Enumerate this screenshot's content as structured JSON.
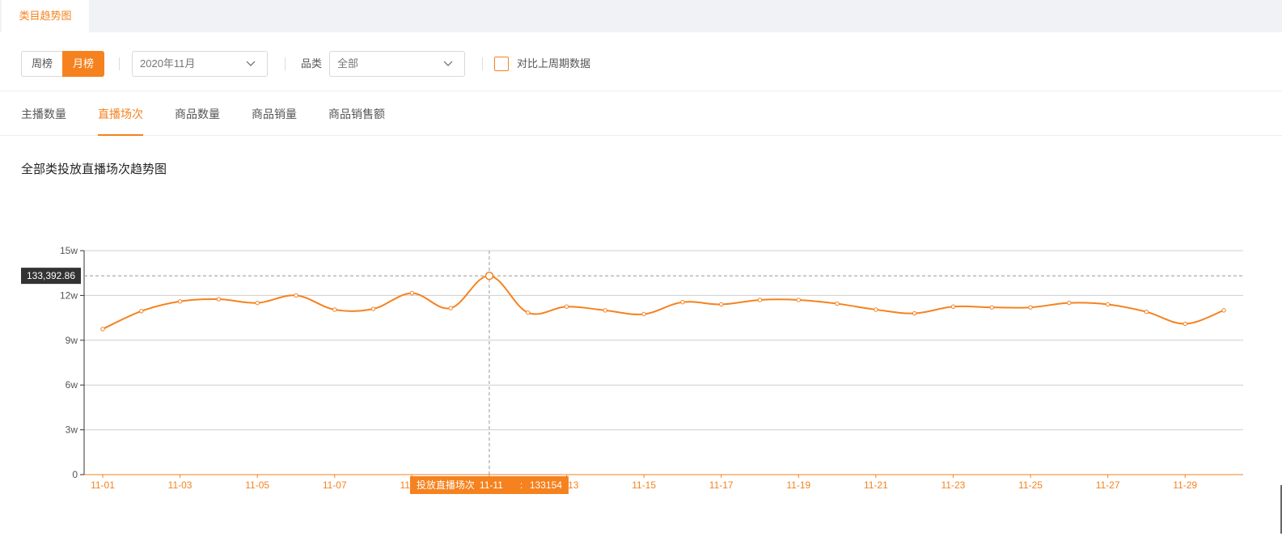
{
  "top_tab": {
    "label": "类目趋势图"
  },
  "filters": {
    "period_week_label": "周榜",
    "period_month_label": "月榜",
    "selected_period": "月榜",
    "month_select_value": "2020年11月",
    "category_label": "品类",
    "category_select_value": "全部",
    "compare_label": "对比上周期数据",
    "compare_checked": false
  },
  "tabs": [
    {
      "label": "主播数量",
      "active": false
    },
    {
      "label": "直播场次",
      "active": true
    },
    {
      "label": "商品数量",
      "active": false
    },
    {
      "label": "商品销量",
      "active": false
    },
    {
      "label": "商品销售额",
      "active": false
    }
  ],
  "colors": {
    "accent": "#f5821f",
    "grid": "#cfcfcf",
    "tooltip_bg": "#333333"
  },
  "chart_data": {
    "type": "line",
    "title": "全部类投放直播场次趋势图",
    "x": [
      "11-01",
      "11-02",
      "11-03",
      "11-04",
      "11-05",
      "11-06",
      "11-07",
      "11-08",
      "11-09",
      "11-10",
      "11-11",
      "11-12",
      "11-13",
      "11-14",
      "11-15",
      "11-16",
      "11-17",
      "11-18",
      "11-19",
      "11-20",
      "11-21",
      "11-22",
      "11-23",
      "11-24",
      "11-25",
      "11-26",
      "11-27",
      "11-28",
      "11-29",
      "11-30"
    ],
    "x_tick_labels": [
      "11-01",
      "11-03",
      "11-05",
      "11-07",
      "11-09",
      "11-11",
      "11-13",
      "11-15",
      "11-17",
      "11-19",
      "11-21",
      "11-23",
      "11-25",
      "11-27",
      "11-29"
    ],
    "series": [
      {
        "name": "投放直播场次",
        "values": [
          97500,
          109500,
          116000,
          117500,
          115000,
          120000,
          110500,
          111000,
          121500,
          111500,
          133154,
          108500,
          112500,
          110000,
          107500,
          115500,
          114000,
          117000,
          117000,
          114500,
          110500,
          108000,
          112500,
          112000,
          112000,
          115000,
          114000,
          109000,
          101000,
          110000
        ]
      }
    ],
    "ylim": [
      0,
      150000
    ],
    "y_ticks": [
      0,
      30000,
      60000,
      90000,
      120000,
      150000
    ],
    "y_tick_labels": [
      "0",
      "3w",
      "6w",
      "9w",
      "12w",
      "15w"
    ],
    "grid": true,
    "crosshair": {
      "x": "11-11",
      "y_readout": "133,392.86"
    },
    "tooltip": {
      "series": "投放直播场次",
      "x": "11-11",
      "value": "133154"
    }
  }
}
